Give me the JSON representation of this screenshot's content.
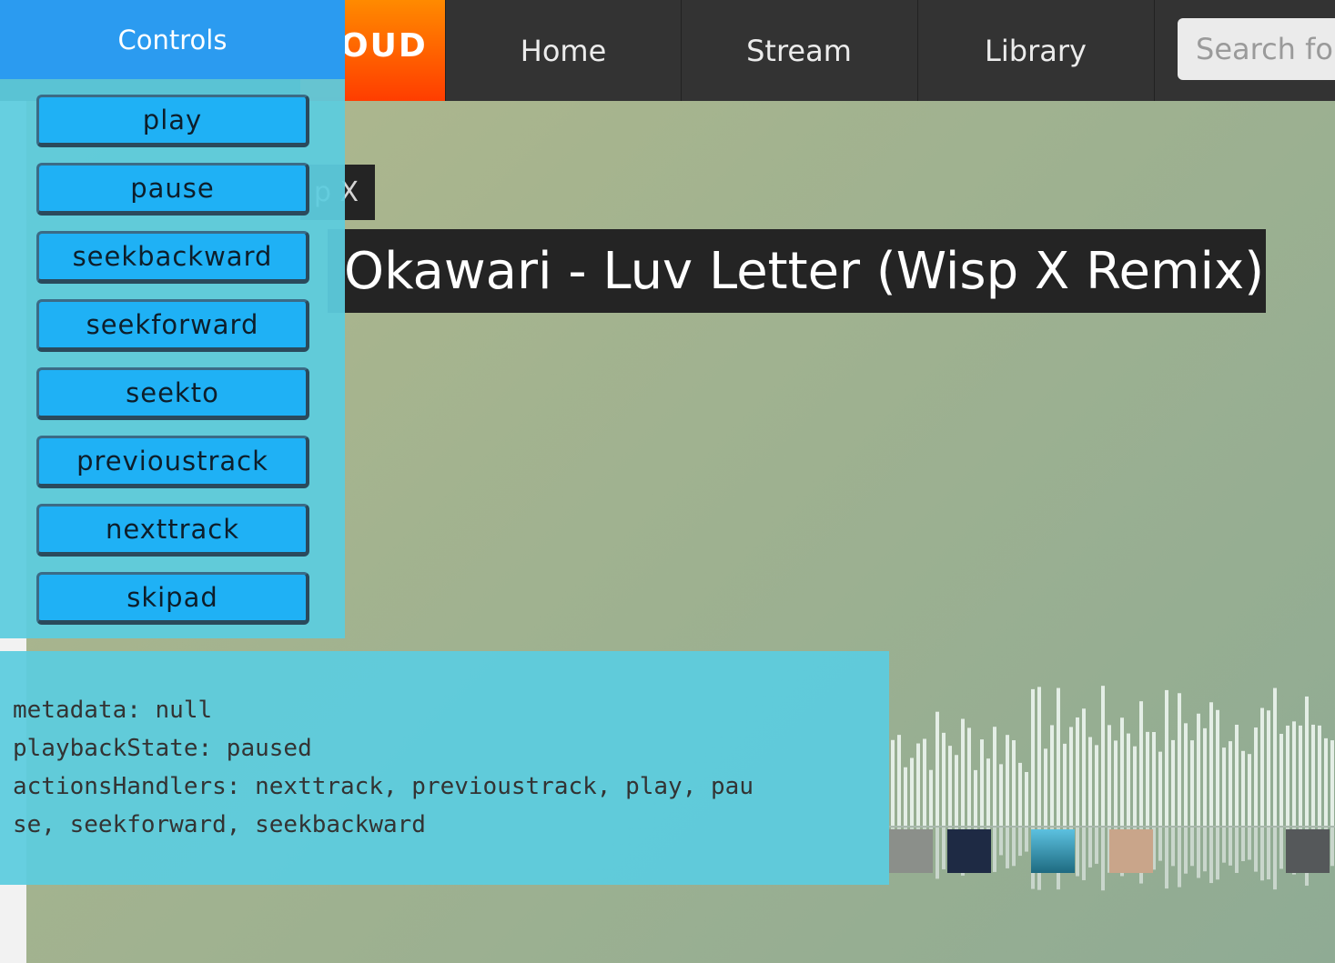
{
  "nav": {
    "logo_text": "OUD",
    "items": [
      "Home",
      "Stream",
      "Library"
    ],
    "search_placeholder": "Search for"
  },
  "track": {
    "artist_fragment": "p X",
    "title": "Okawari - Luv Letter (Wisp X Remix)"
  },
  "controls": {
    "header": "Controls",
    "buttons": [
      "play",
      "pause",
      "seekbackward",
      "seekforward",
      "seekto",
      "previoustrack",
      "nexttrack",
      "skipad"
    ]
  },
  "metadata_panel": {
    "line1": "metadata: null",
    "line2": "playbackState: paused",
    "line3": "actionsHandlers: nexttrack, previoustrack, play, pau",
    "line4": "se, seekforward, seekbackward"
  },
  "colors": {
    "controls_header": "#2b9bf0",
    "panel": "#5cccde",
    "button": "#1fb1f5",
    "logo": "#ff5500"
  }
}
